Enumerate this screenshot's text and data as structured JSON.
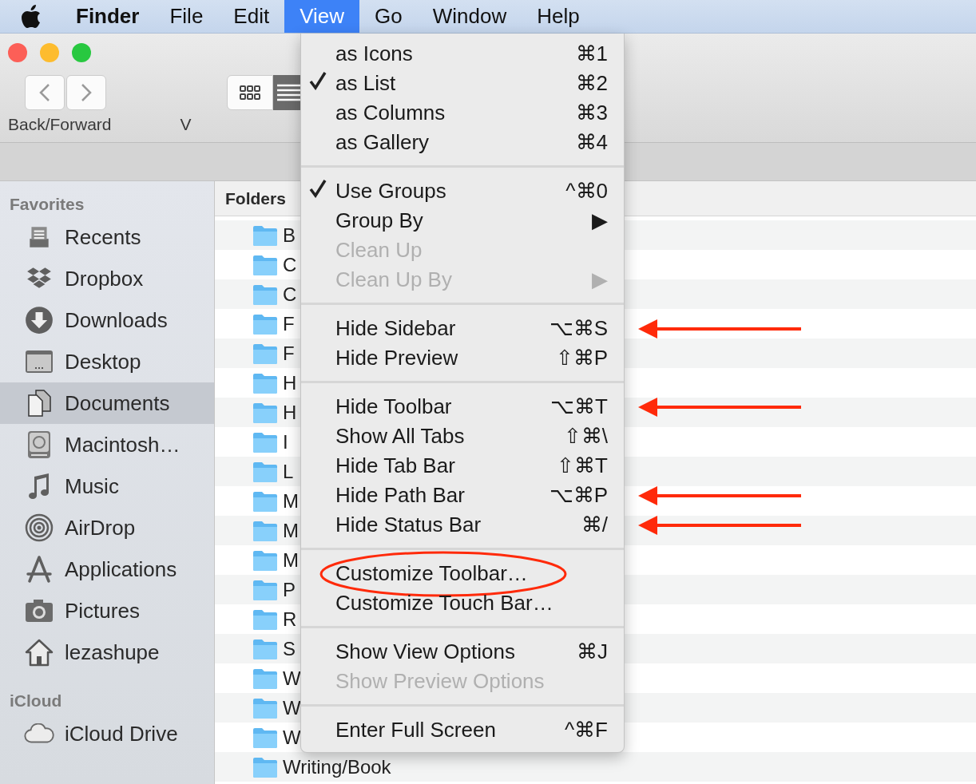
{
  "menu_bar": {
    "items": [
      {
        "label": "Finder",
        "kind": "app",
        "selected": false
      },
      {
        "label": "File",
        "kind": "menu",
        "selected": false
      },
      {
        "label": "Edit",
        "kind": "menu",
        "selected": false
      },
      {
        "label": "View",
        "kind": "menu",
        "selected": true
      },
      {
        "label": "Go",
        "kind": "menu",
        "selected": false
      },
      {
        "label": "Window",
        "kind": "menu",
        "selected": false
      },
      {
        "label": "Help",
        "kind": "menu",
        "selected": false
      }
    ]
  },
  "window": {
    "toolbar": {
      "navigation_label": "Back/Forward",
      "view_label": "V",
      "view_buttons": [
        {
          "kind": "icons",
          "selected": false
        },
        {
          "kind": "list",
          "selected": true
        }
      ]
    },
    "sidebar": {
      "sections": [
        {
          "title": "Favorites",
          "items": [
            {
              "label": "Recents",
              "kind": "recents",
              "selected": false
            },
            {
              "label": "Dropbox",
              "kind": "dropbox",
              "selected": false
            },
            {
              "label": "Downloads",
              "kind": "downloads",
              "selected": false
            },
            {
              "label": "Desktop",
              "kind": "desktop",
              "selected": false
            },
            {
              "label": "Documents",
              "kind": "documents",
              "selected": true
            },
            {
              "label": "Macintosh…",
              "kind": "disk",
              "selected": false
            },
            {
              "label": "Music",
              "kind": "music",
              "selected": false
            },
            {
              "label": "AirDrop",
              "kind": "airdrop",
              "selected": false
            },
            {
              "label": "Applications",
              "kind": "applications",
              "selected": false
            },
            {
              "label": "Pictures",
              "kind": "pictures",
              "selected": false
            },
            {
              "label": "lezashupe",
              "kind": "home",
              "selected": false
            }
          ]
        },
        {
          "title": "iCloud",
          "items": [
            {
              "label": "iCloud Drive",
              "kind": "cloud",
              "selected": false
            }
          ]
        }
      ]
    },
    "file_list": {
      "column_header": "Folders",
      "rows": [
        "B",
        "C",
        "C",
        "F",
        "F",
        "H",
        "H",
        "I",
        "L",
        "M",
        "M",
        "M",
        "P",
        "R",
        "S",
        "W",
        "W",
        "W",
        "Writing/Book"
      ]
    }
  },
  "view_menu": {
    "sections": [
      {
        "items": [
          {
            "label": "as Icons",
            "shortcut": "⌘1",
            "checked": false,
            "disabled": false,
            "pointed_at": false,
            "circled": false
          },
          {
            "label": "as List",
            "shortcut": "⌘2",
            "checked": true,
            "disabled": false,
            "pointed_at": false,
            "circled": false
          },
          {
            "label": "as Columns",
            "shortcut": "⌘3",
            "checked": false,
            "disabled": false,
            "pointed_at": false,
            "circled": false
          },
          {
            "label": "as Gallery",
            "shortcut": "⌘4",
            "checked": false,
            "disabled": false,
            "pointed_at": false,
            "circled": false
          }
        ]
      },
      {
        "items": [
          {
            "label": "Use Groups",
            "shortcut": "^⌘0",
            "checked": true,
            "disabled": false,
            "pointed_at": false,
            "circled": false
          },
          {
            "label": "Group By",
            "shortcut": "▶",
            "checked": false,
            "disabled": false,
            "pointed_at": false,
            "circled": false
          },
          {
            "label": "Clean Up",
            "checked": false,
            "disabled": true,
            "pointed_at": false,
            "circled": false
          },
          {
            "label": "Clean Up By",
            "shortcut": "▶",
            "checked": false,
            "disabled": true,
            "pointed_at": false,
            "circled": false
          }
        ]
      },
      {
        "items": [
          {
            "label": "Hide Sidebar",
            "shortcut": "⌥⌘S",
            "checked": false,
            "disabled": false,
            "pointed_at": true,
            "circled": false
          },
          {
            "label": "Hide Preview",
            "shortcut": "⇧⌘P",
            "checked": false,
            "disabled": false,
            "pointed_at": false,
            "circled": false
          }
        ]
      },
      {
        "items": [
          {
            "label": "Hide Toolbar",
            "shortcut": "⌥⌘T",
            "checked": false,
            "disabled": false,
            "pointed_at": true,
            "circled": false
          },
          {
            "label": "Show All Tabs",
            "shortcut": "⇧⌘\\",
            "checked": false,
            "disabled": false,
            "pointed_at": false,
            "circled": false
          },
          {
            "label": "Hide Tab Bar",
            "shortcut": "⇧⌘T",
            "checked": false,
            "disabled": false,
            "pointed_at": false,
            "circled": false
          },
          {
            "label": "Hide Path Bar",
            "shortcut": "⌥⌘P",
            "checked": false,
            "disabled": false,
            "pointed_at": true,
            "circled": false
          },
          {
            "label": "Hide Status Bar",
            "shortcut": "⌘/",
            "checked": false,
            "disabled": false,
            "pointed_at": true,
            "circled": false
          }
        ]
      },
      {
        "items": [
          {
            "label": "Customize Toolbar…",
            "checked": false,
            "disabled": false,
            "pointed_at": false,
            "circled": true
          },
          {
            "label": "Customize Touch Bar…",
            "checked": false,
            "disabled": false,
            "pointed_at": false,
            "circled": false
          }
        ]
      },
      {
        "items": [
          {
            "label": "Show View Options",
            "shortcut": "⌘J",
            "checked": false,
            "disabled": false,
            "pointed_at": false,
            "circled": false
          },
          {
            "label": "Show Preview Options",
            "checked": false,
            "disabled": true,
            "pointed_at": false,
            "circled": false
          }
        ]
      },
      {
        "items": [
          {
            "label": "Enter Full Screen",
            "shortcut": "^⌘F",
            "checked": false,
            "disabled": false,
            "pointed_at": false,
            "circled": false
          }
        ]
      }
    ]
  }
}
